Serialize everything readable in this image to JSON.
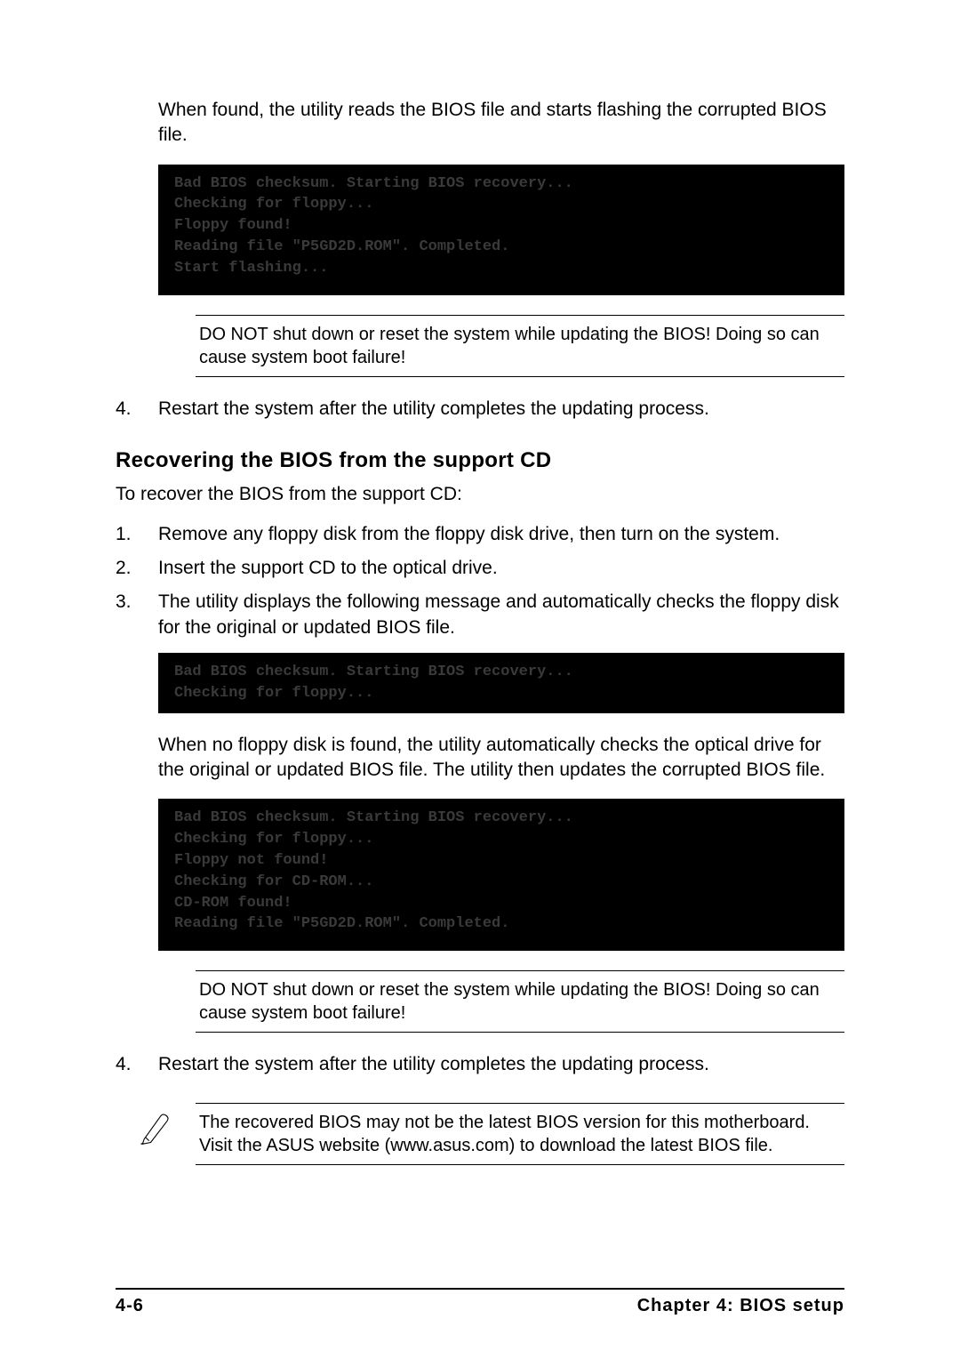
{
  "intro1": "When found, the utility reads the BIOS file and starts flashing the corrupted BIOS file.",
  "terminal1": "Bad BIOS checksum. Starting BIOS recovery...\nChecking for floppy...\nFloppy found!\nReading file \"P5GD2D.ROM\". Completed.\nStart flashing...",
  "warning1": "DO NOT shut down or reset the system while updating the BIOS! Doing so can cause system boot failure!",
  "list1": {
    "n4": "4.",
    "t4": "Restart the system after the utility completes the updating process."
  },
  "heading": "Recovering the BIOS from the support CD",
  "sub": "To recover the BIOS from the support CD:",
  "list2": {
    "n1": "1.",
    "t1": "Remove any floppy disk from the floppy disk drive, then turn on the system.",
    "n2": "2.",
    "t2": "Insert the support CD to the optical drive.",
    "n3": "3.",
    "t3": "The utility displays the following message and automatically checks the floppy disk for the original or updated BIOS file."
  },
  "terminal2": "Bad BIOS checksum. Starting BIOS recovery...\nChecking for floppy...",
  "para2": "When no floppy disk is found, the utility automatically checks the optical drive for the original or updated BIOS file. The utility then updates the corrupted BIOS file.",
  "terminal3": "Bad BIOS checksum. Starting BIOS recovery...\nChecking for floppy...\nFloppy not found!\nChecking for CD-ROM...\nCD-ROM found!\nReading file \"P5GD2D.ROM\". Completed.",
  "warning2": "DO NOT shut down or reset the system while updating the BIOS! Doing so can cause system boot failure!",
  "list3": {
    "n4": "4.",
    "t4": "Restart the system after the utility completes the updating process."
  },
  "note": "The recovered BIOS may not be the latest BIOS version for this motherboard. Visit the ASUS website (www.asus.com) to download the latest BIOS file.",
  "footer": {
    "page": "4-6",
    "chapter": "Chapter 4: BIOS setup"
  }
}
